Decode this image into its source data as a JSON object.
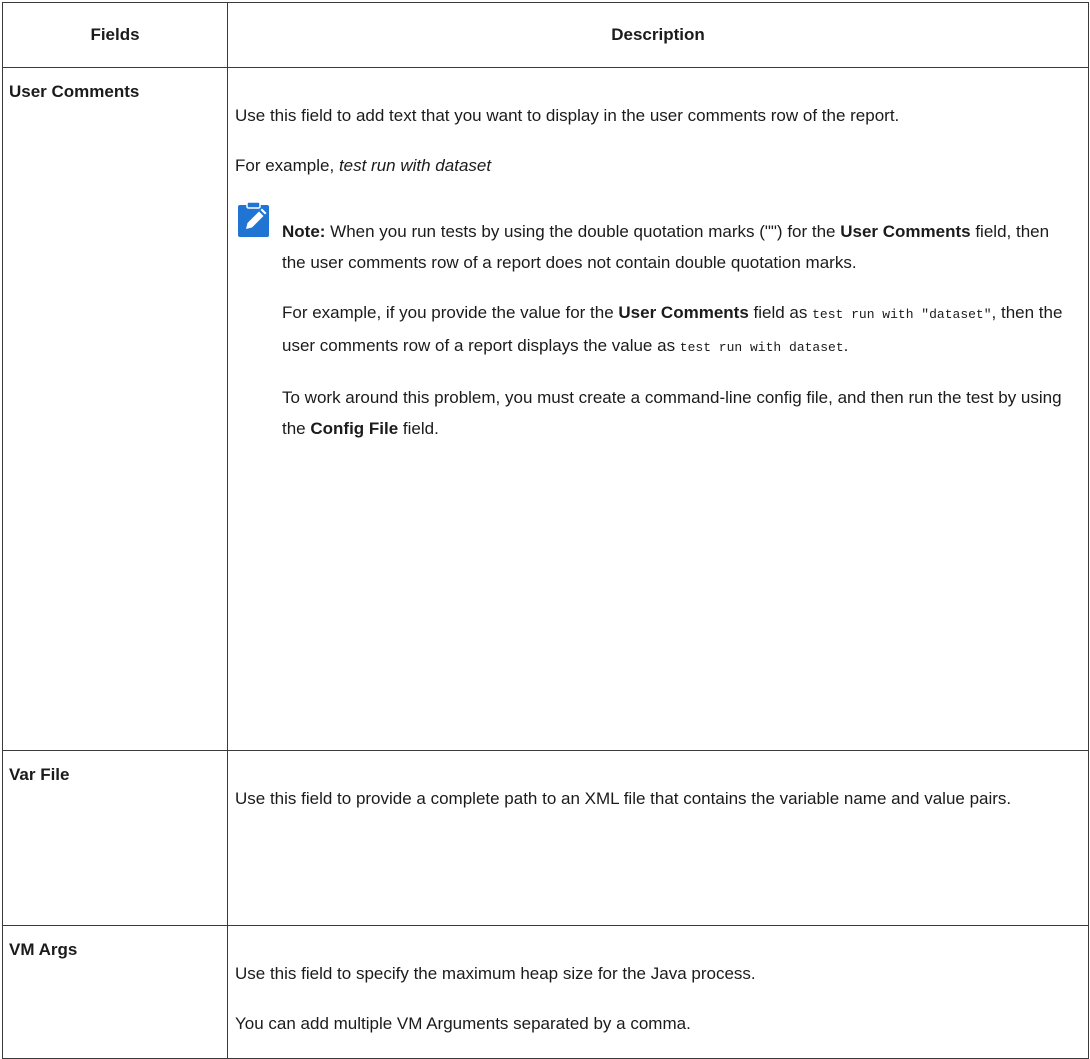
{
  "table": {
    "headers": {
      "fields": "Fields",
      "description": "Description"
    },
    "rows": [
      {
        "field": "User Comments",
        "para1": "Use this field to add text that you want to display in the user comments row of the report.",
        "example_prefix": "For example, ",
        "example_value": "test run with dataset",
        "note": {
          "label": "Note:",
          "p1_a": " When you run tests by using the double quotation marks (\"\") for the ",
          "p1_b": "User Comments",
          "p1_c": " field, then the user comments row of a report does not contain double quotation marks.",
          "p2_a": "For example, if you provide the value for the ",
          "p2_b": "User Comments",
          "p2_c": " field as ",
          "p2_code1": "test run with \"dataset\"",
          "p2_d": ", then the user comments row of a report displays the value as ",
          "p2_code2": "test run with dataset",
          "p2_e": ".",
          "p3_a": "To work around this problem, you must create a command-line config file, and then run the test by using the ",
          "p3_b": "Config File",
          "p3_c": " field."
        }
      },
      {
        "field": "Var File",
        "para1": "Use this field to provide a complete path to an XML file that contains the variable name and value pairs."
      },
      {
        "field": "VM Args",
        "para1": "Use this field to specify the maximum heap size for the Java process.",
        "para2": "You can add multiple VM Arguments separated by a comma."
      }
    ]
  },
  "icons": {
    "note_icon": "pencil-note-icon",
    "note_icon_color": "#1f74d4"
  }
}
